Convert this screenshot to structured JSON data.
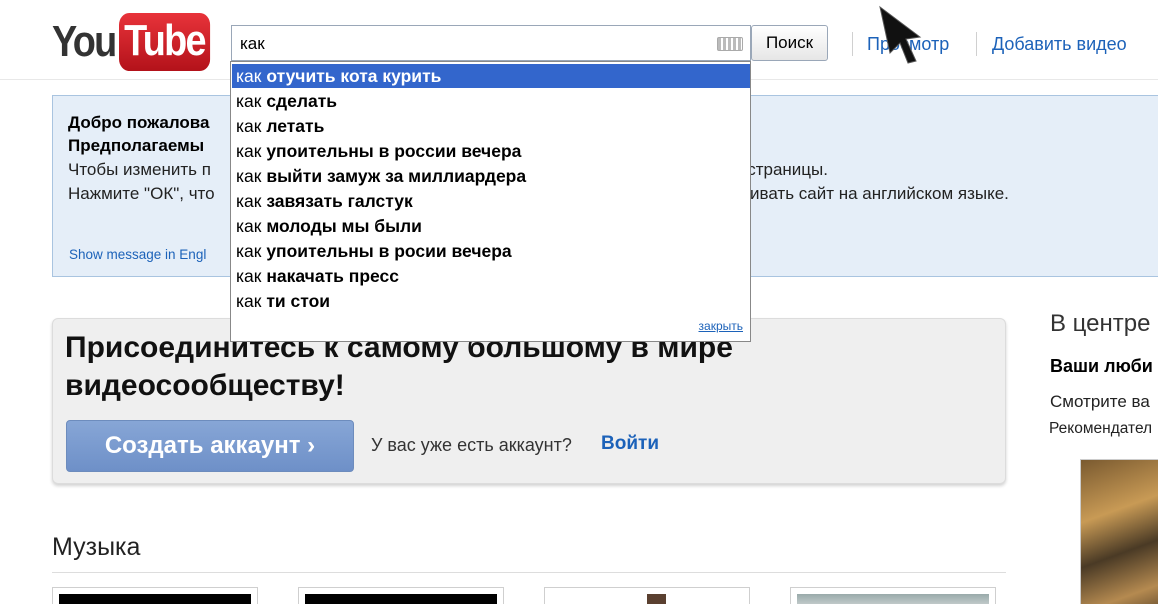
{
  "header": {
    "logo": "YouTube",
    "search": {
      "value": "как",
      "button": "Поиск"
    },
    "links": [
      "Просмотр",
      "Добавить видео"
    ]
  },
  "suggestions": {
    "items": [
      {
        "prefix": "как",
        "completion": "отучить кота курить"
      },
      {
        "prefix": "как",
        "completion": "сделать"
      },
      {
        "prefix": "как",
        "completion": "летать"
      },
      {
        "prefix": "как",
        "completion": "упоительны в россии вечера"
      },
      {
        "prefix": "как",
        "completion": "выйти замуж за миллиардера"
      },
      {
        "prefix": "как",
        "completion": "завязать галстук"
      },
      {
        "prefix": "как",
        "completion": "молоды мы были"
      },
      {
        "prefix": "как",
        "completion": "упоительны в росии вечера"
      },
      {
        "prefix": "как",
        "completion": "накачать пресс"
      },
      {
        "prefix": "как",
        "completion": "ти стои"
      }
    ],
    "close": "закрыть"
  },
  "notice": {
    "line1": "Добро пожалова",
    "line2": "Предполагаемы",
    "line3a": "Чтобы изменить п",
    "line3b": "и страницы.",
    "line4a": "Нажмите \"ОК\", что",
    "line4b": "ивать сайт на английском языке.",
    "english_link": "Show message in Engl"
  },
  "join": {
    "title": "Присоединитесь к самому большому в мире видеосообществу!",
    "button": "Создать аккаунт ›",
    "have_account": "У вас уже есть аккаунт?",
    "login": "Войти"
  },
  "right_column": {
    "heading": "В центре",
    "bold": "Ваши люби",
    "line1": "Смотрите ва",
    "line2": "Рекомендател"
  },
  "music": {
    "title": "Музыка"
  }
}
